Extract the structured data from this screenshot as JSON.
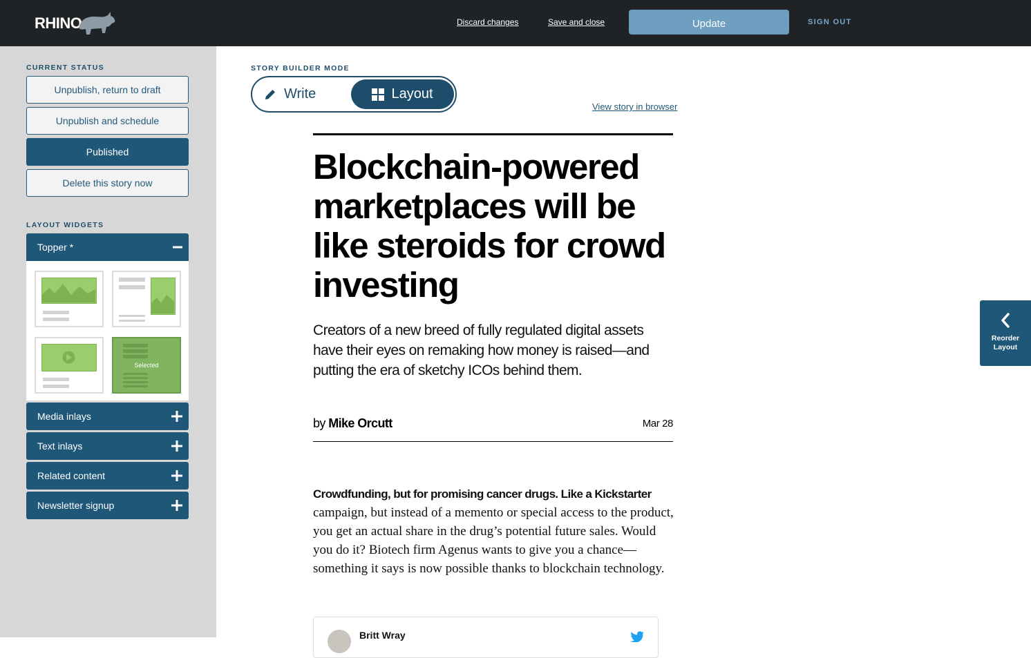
{
  "header": {
    "logo_text": "RHINO",
    "discard_label": "Discard changes",
    "save_close_label": "Save and close",
    "update_label": "Update",
    "signout_label": "SIGN OUT"
  },
  "sidebar": {
    "status_title": "CURRENT STATUS",
    "status_buttons": {
      "unpublish_draft": "Unpublish, return to draft",
      "unpublish_schedule": "Unpublish and schedule",
      "published": "Published",
      "delete_now": "Delete this story now"
    },
    "widgets_title": "LAYOUT WIDGETS",
    "topper": {
      "label": "Topper *",
      "selected_label": "Selected"
    },
    "widgets": {
      "media_inlays": "Media inlays",
      "text_inlays": "Text inlays",
      "related_content": "Related content",
      "newsletter_signup": "Newsletter signup"
    }
  },
  "story_builder": {
    "mode_label": "STORY BUILDER MODE",
    "write_label": "Write",
    "layout_label": "Layout",
    "active_mode": "Layout",
    "view_link": "View story in browser"
  },
  "article": {
    "headline": "Blockchain-powered marketplaces will be like steroids for crowd investing",
    "dek": "Creators of a new breed of fully regulated digital assets have their eyes on remaking how money is raised—and putting the era of sketchy ICOs behind them.",
    "by_prefix": "by",
    "author": "Mike Orcutt",
    "date": "Mar 28",
    "body_lead": "Crowdfunding, but for promising cancer drugs. Like a Kickstarter",
    "body_rest": "campaign, but instead of a memento or special access to the product, you get an actual share in the drug’s potential future sales. Would you do it? Biotech firm Agenus wants to give you a chance—something it says is now possible thanks to blockchain technology.",
    "tweet_author": "Britt Wray"
  },
  "reorder": {
    "label": "Reorder Layout"
  },
  "colors": {
    "navy": "#1f5779",
    "topbar": "#1f2326",
    "update_button": "#6e9fc0",
    "widget_green": "#9acd6b"
  },
  "icons": {
    "write": "pencil-icon",
    "layout": "grid-icon",
    "expand": "plus-icon",
    "collapse": "minus-icon",
    "reorder": "chevron-left-icon",
    "tweet": "twitter-bird-icon"
  }
}
